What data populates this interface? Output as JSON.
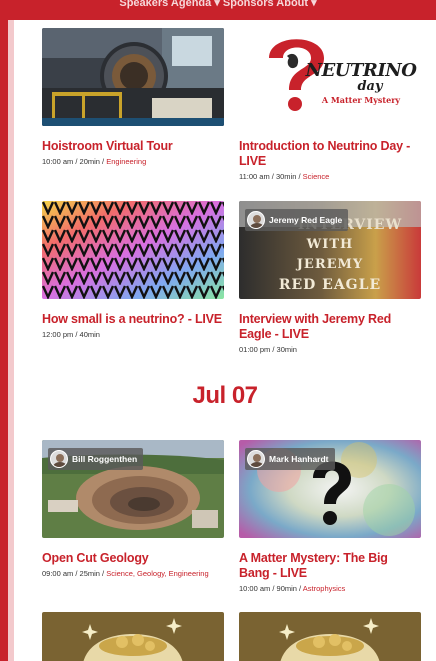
{
  "nav": {
    "items_text": "Speakers    Agenda ▾    Sponsors    About ▾"
  },
  "colors": {
    "accent": "#c8222b"
  },
  "date_heading": "Jul 07",
  "sessions": [
    {
      "title": "Hoistroom Virtual Tour",
      "time": "10:00 am / 20min / ",
      "categories": "Engineering",
      "speaker": ""
    },
    {
      "title": "Introduction to Neutrino Day - LIVE",
      "time": "11:00 am / 30min / ",
      "categories": "Science",
      "speaker": "",
      "logo_text": {
        "word": "NEUTRINO",
        "day": "day",
        "tagline": "A Matter Mystery"
      }
    },
    {
      "title": "How small is a neutrino? - LIVE",
      "time": "12:00 pm / 40min",
      "categories": "",
      "speaker": ""
    },
    {
      "title": "Interview with Jeremy Red Eagle - LIVE",
      "time": "01:00 pm / 30min",
      "categories": "",
      "speaker": "Jeremy Red Eagle",
      "thumb_text": [
        "INTERVIEW",
        "WITH",
        "JEREMY",
        "RED EAGLE"
      ]
    },
    {
      "title": "Open Cut Geology",
      "time": "09:00 am / 25min / ",
      "categories": "Science, Geology, Engineering",
      "speaker": "Bill Roggenthen"
    },
    {
      "title": "A Matter Mystery: The Big Bang - LIVE",
      "time": "10:00 am / 90min / ",
      "categories": "Astrophysics",
      "speaker": "Mark Hanhardt"
    }
  ]
}
